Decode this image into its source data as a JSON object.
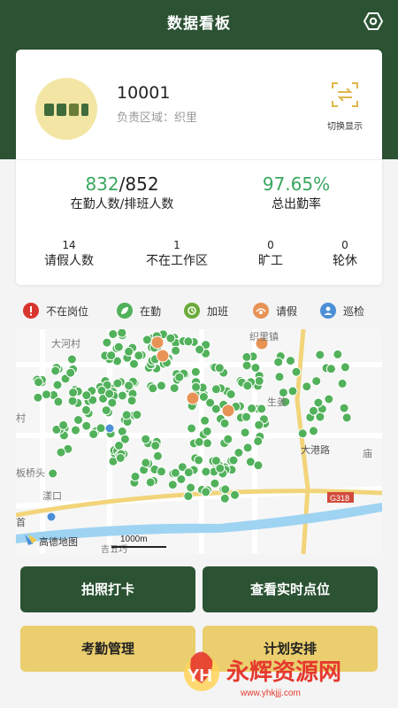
{
  "header": {
    "title": "数据看板",
    "settings_icon": "settings-icon"
  },
  "profile": {
    "id": "10001",
    "region": "负责区域：织里",
    "switch_label": "切换显示",
    "switch_icon": "switch-display-icon"
  },
  "summary": {
    "onduty": "832",
    "slash": "/",
    "scheduled": "852",
    "onduty_label": "在勤人数/排班人数",
    "attendance_rate": "97.65%",
    "attendance_label": "总出勤率"
  },
  "counts": [
    {
      "value": "14",
      "label": "请假人数"
    },
    {
      "value": "1",
      "label": "不在工作区"
    },
    {
      "value": "0",
      "label": "旷工"
    },
    {
      "value": "0",
      "label": "轮休"
    }
  ],
  "legend": [
    {
      "label": "不在岗位",
      "color": "#d9352f",
      "icon": "alert-icon"
    },
    {
      "label": "在勤",
      "color": "#52b15b",
      "icon": "leaf-icon"
    },
    {
      "label": "加班",
      "color": "#6aaa3a",
      "icon": "overtime-icon"
    },
    {
      "label": "请假",
      "color": "#e89356",
      "icon": "leave-icon"
    },
    {
      "label": "巡检",
      "color": "#4b8fd6",
      "icon": "patrol-icon"
    }
  ],
  "map": {
    "place_labels": [
      "大河村",
      "织里镇",
      "生姜",
      "村",
      "板桥头",
      "漾口",
      "庙",
      "大港路",
      "G318",
      "首",
      "吉五巧"
    ],
    "scale": "1000m",
    "provider": "高德地图"
  },
  "buttons": {
    "checkin": "拍照打卡",
    "realtime": "查看实时点位",
    "attendance": "考勤管理",
    "schedule": "计划安排"
  },
  "watermark": {
    "logo": "YH",
    "text": "永辉资源网",
    "url": "www.yhkjjj.com"
  },
  "colors": {
    "brand_green": "#2b5233",
    "accent_yellow": "#ebce6d",
    "value_green": "#3aa760"
  }
}
